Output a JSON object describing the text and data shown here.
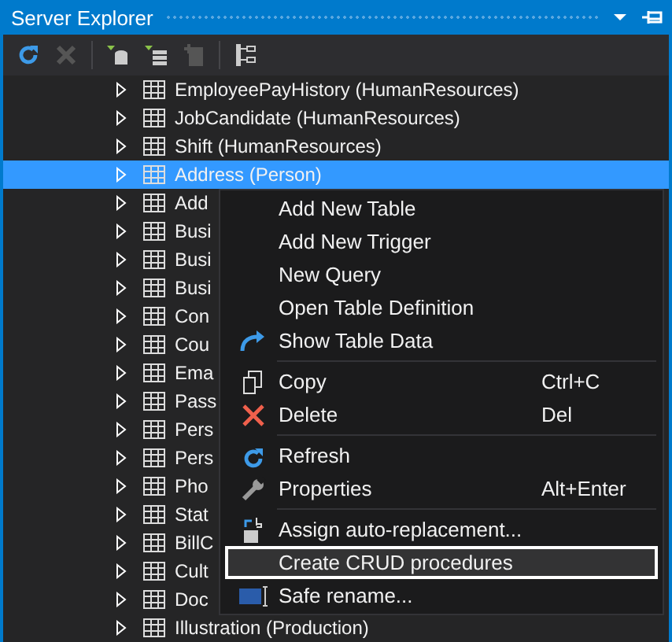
{
  "window": {
    "title": "Server Explorer"
  },
  "tree": {
    "rows": [
      {
        "label": "EmployeePayHistory (HumanResources)",
        "selected": false
      },
      {
        "label": "JobCandidate (HumanResources)",
        "selected": false
      },
      {
        "label": "Shift (HumanResources)",
        "selected": false
      },
      {
        "label": "Address (Person)",
        "selected": true
      },
      {
        "label": "Add",
        "selected": false
      },
      {
        "label": "Busi",
        "selected": false
      },
      {
        "label": "Busi",
        "selected": false
      },
      {
        "label": "Busi",
        "selected": false
      },
      {
        "label": "Con",
        "selected": false
      },
      {
        "label": "Cou",
        "selected": false
      },
      {
        "label": "Ema",
        "selected": false
      },
      {
        "label": "Pass",
        "selected": false
      },
      {
        "label": "Pers",
        "selected": false
      },
      {
        "label": "Pers",
        "selected": false
      },
      {
        "label": "Pho",
        "selected": false
      },
      {
        "label": "Stat",
        "selected": false
      },
      {
        "label": "BillC",
        "selected": false
      },
      {
        "label": "Cult",
        "selected": false
      },
      {
        "label": "Doc",
        "selected": false
      },
      {
        "label": "Illustration (Production)",
        "selected": false
      }
    ]
  },
  "context_menu": {
    "groups": [
      [
        {
          "label": "Add New Table",
          "selected": false
        },
        {
          "label": "Add New Trigger",
          "selected": false
        },
        {
          "label": "New Query",
          "selected": false
        },
        {
          "label": "Open Table Definition",
          "selected": false
        },
        {
          "label": "Show Table Data",
          "selected": false
        }
      ],
      [
        {
          "label": "Copy",
          "shortcut": "Ctrl+C",
          "selected": false
        },
        {
          "label": "Delete",
          "shortcut": "Del",
          "selected": false
        }
      ],
      [
        {
          "label": "Refresh",
          "selected": false
        },
        {
          "label": "Properties",
          "shortcut": "Alt+Enter",
          "selected": false
        }
      ],
      [
        {
          "label": "Assign auto-replacement...",
          "selected": false
        },
        {
          "label": "Create CRUD procedures",
          "selected": true
        },
        {
          "label": "Safe rename...",
          "selected": false
        }
      ]
    ]
  }
}
